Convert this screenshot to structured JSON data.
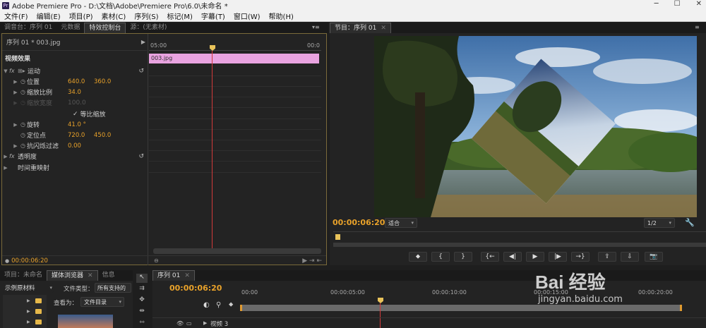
{
  "window": {
    "title": "Adobe Premiere Pro - D:\\文档\\Adobe\\Premiere Pro\\6.0\\未命名 *",
    "app_icon": "Pr",
    "controls": [
      "─",
      "☐",
      "✕"
    ]
  },
  "menu": [
    "文件(F)",
    "编辑(E)",
    "项目(P)",
    "素材(C)",
    "序列(S)",
    "标记(M)",
    "字幕(T)",
    "窗口(W)",
    "帮助(H)"
  ],
  "left_tabs": [
    "调音台：序列 01",
    "元数据",
    "特效控制台",
    "源：(无素材)"
  ],
  "effect_controls": {
    "header": "序列 01 * 003.jpg",
    "section": "视频效果",
    "ruler_time": "05:00",
    "ruler_end": "00:0",
    "clip_label": "003.jpg",
    "rows": [
      {
        "name": "运动"
      },
      {
        "name": "位置",
        "v1": "640.0",
        "v2": "360.0"
      },
      {
        "name": "缩放比例",
        "v1": "34.0"
      },
      {
        "name": "缩放宽度",
        "v1": "100.0"
      },
      {
        "name": "等比缩放"
      },
      {
        "name": "旋转",
        "v1": "41.0 °"
      },
      {
        "name": "定位点",
        "v1": "720.0",
        "v2": "450.0"
      },
      {
        "name": "抗闪烁过滤",
        "v1": "0.00"
      },
      {
        "name": "透明度"
      },
      {
        "name": "时间重映射"
      }
    ],
    "timecode": "00:00:06:20"
  },
  "program": {
    "tab": "节目：序列 01",
    "timecode": "00:00:06:20",
    "fit": "适合",
    "quality": "1/2"
  },
  "bottom_left": {
    "tabs": [
      "项目：未命名",
      "媒体浏览器",
      "信息"
    ],
    "drive": "示例原材料",
    "filetype_label": "文件类型：",
    "filetype_value": "所有支持的",
    "viewas_label": "查看为：",
    "viewas_value": "文件目录"
  },
  "timeline": {
    "tab": "序列 01",
    "timecode": "00:00:06:20",
    "ruler": [
      "00:00",
      "00:00:05:00",
      "00:00:10:00",
      "00:00:15:00",
      "00:00:20:00"
    ],
    "track": "视频 3"
  },
  "watermark": {
    "brand": "Bai 经验",
    "url": "jingyan.baidu.com"
  }
}
